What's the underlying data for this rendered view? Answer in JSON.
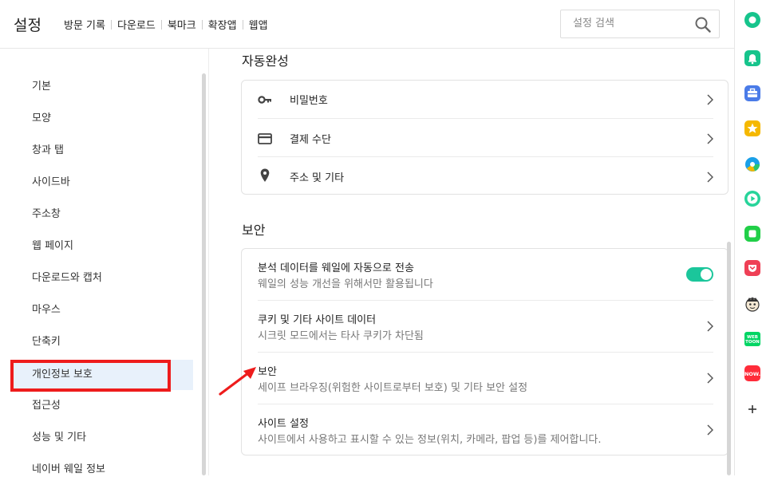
{
  "header": {
    "title": "설정",
    "nav": [
      "방문 기록",
      "다운로드",
      "북마크",
      "확장앱",
      "웹앱"
    ],
    "search_placeholder": "설정 검색"
  },
  "sidebar": {
    "items": [
      {
        "label": "기본"
      },
      {
        "label": "모양"
      },
      {
        "label": "창과 탭"
      },
      {
        "label": "사이드바"
      },
      {
        "label": "주소창"
      },
      {
        "label": "웹 페이지"
      },
      {
        "label": "다운로드와 캡처"
      },
      {
        "label": "마우스"
      },
      {
        "label": "단축키"
      },
      {
        "label": "개인정보 보호",
        "active": true
      },
      {
        "label": "접근성"
      },
      {
        "label": "성능 및 기타"
      },
      {
        "label": "네이버 웨일 정보"
      }
    ]
  },
  "autofill": {
    "title": "자동완성",
    "items": [
      {
        "label": "비밀번호",
        "icon": "key-icon"
      },
      {
        "label": "결제 수단",
        "icon": "credit-card-icon"
      },
      {
        "label": "주소 및 기타",
        "icon": "location-pin-icon"
      }
    ]
  },
  "security": {
    "title": "보안",
    "items": [
      {
        "label": "분석 데이터를 웨일에 자동으로 전송",
        "sub": "웨일의 성능 개선을 위해서만 활용됩니다",
        "control": "toggle",
        "enabled": true
      },
      {
        "label": "쿠키 및 기타 사이트 데이터",
        "sub": "시크릿 모드에서는 타사 쿠키가 차단됨",
        "control": "chevron"
      },
      {
        "label": "보안",
        "sub": "세이프 브라우징(위험한 사이트로부터 보호) 및 기타 보안 설정",
        "control": "chevron"
      },
      {
        "label": "사이트 설정",
        "sub": "사이트에서 사용하고 표시할 수 있는 정보(위치, 카메라, 팝업 등)를 제어합니다.",
        "control": "chevron"
      }
    ]
  },
  "right_sidebar": {
    "icons": [
      "green-circle-app-icon",
      "green-bell-icon",
      "blue-briefcase-icon",
      "yellow-star-icon",
      "pie-chart-icon",
      "green-play-icon",
      "green-square-icon",
      "red-pocket-icon",
      "character-avatar-icon",
      "webtoon-icon",
      "now-icon",
      "add-icon"
    ],
    "webtoon_text": "WEB TOON",
    "now_text": "NOW."
  },
  "colors": {
    "accent_toggle": "#1bc69b",
    "highlight": "#ee1c1c",
    "active_nav_bg": "#e8f1fb"
  }
}
